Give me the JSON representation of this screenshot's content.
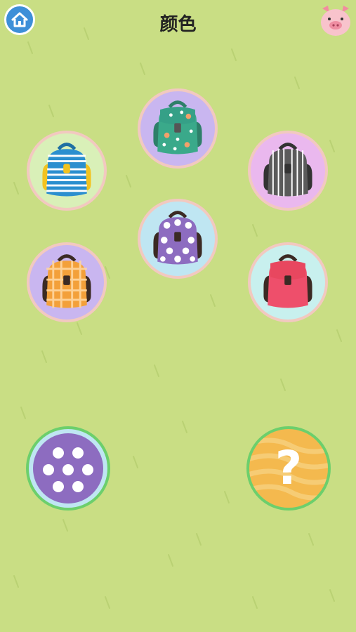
{
  "header": {
    "title": "颜色",
    "home_icon": "home-icon",
    "profile_icon": "pig-face-icon"
  },
  "colors": {
    "background": "#c9de84",
    "home_button": "#3d8fd8",
    "answer_border": "#6ccf6c",
    "bag_border": "#f2c9c0"
  },
  "backpacks": [
    {
      "id": "flower-green",
      "pattern": "flowers",
      "color": "#3aa98a",
      "circle_bg": "#c9b6f0"
    },
    {
      "id": "stripe-blue",
      "pattern": "horizontal-stripes",
      "color": "#2b8fcf",
      "circle_bg": "#d9f0b8"
    },
    {
      "id": "stripe-gray",
      "pattern": "vertical-stripes",
      "color": "#5b5b5b",
      "circle_bg": "#eab8ee"
    },
    {
      "id": "dots-purple",
      "pattern": "polka-dots",
      "color": "#8d6cc0",
      "circle_bg": "#bfe6f2"
    },
    {
      "id": "plaid-orange",
      "pattern": "plaid",
      "color": "#f3a03a",
      "circle_bg": "#c9b6f0"
    },
    {
      "id": "solid-pink",
      "pattern": "solid",
      "color": "#ee4f6b",
      "circle_bg": "#c8f0ee"
    }
  ],
  "answer_slots": [
    {
      "id": "target-pattern",
      "icon": "purple-polka-dot-icon",
      "fill": "#8d6cc0"
    },
    {
      "id": "unknown",
      "label": "?",
      "icon": "question-mark-icon",
      "fill": "#f4b94e"
    }
  ]
}
